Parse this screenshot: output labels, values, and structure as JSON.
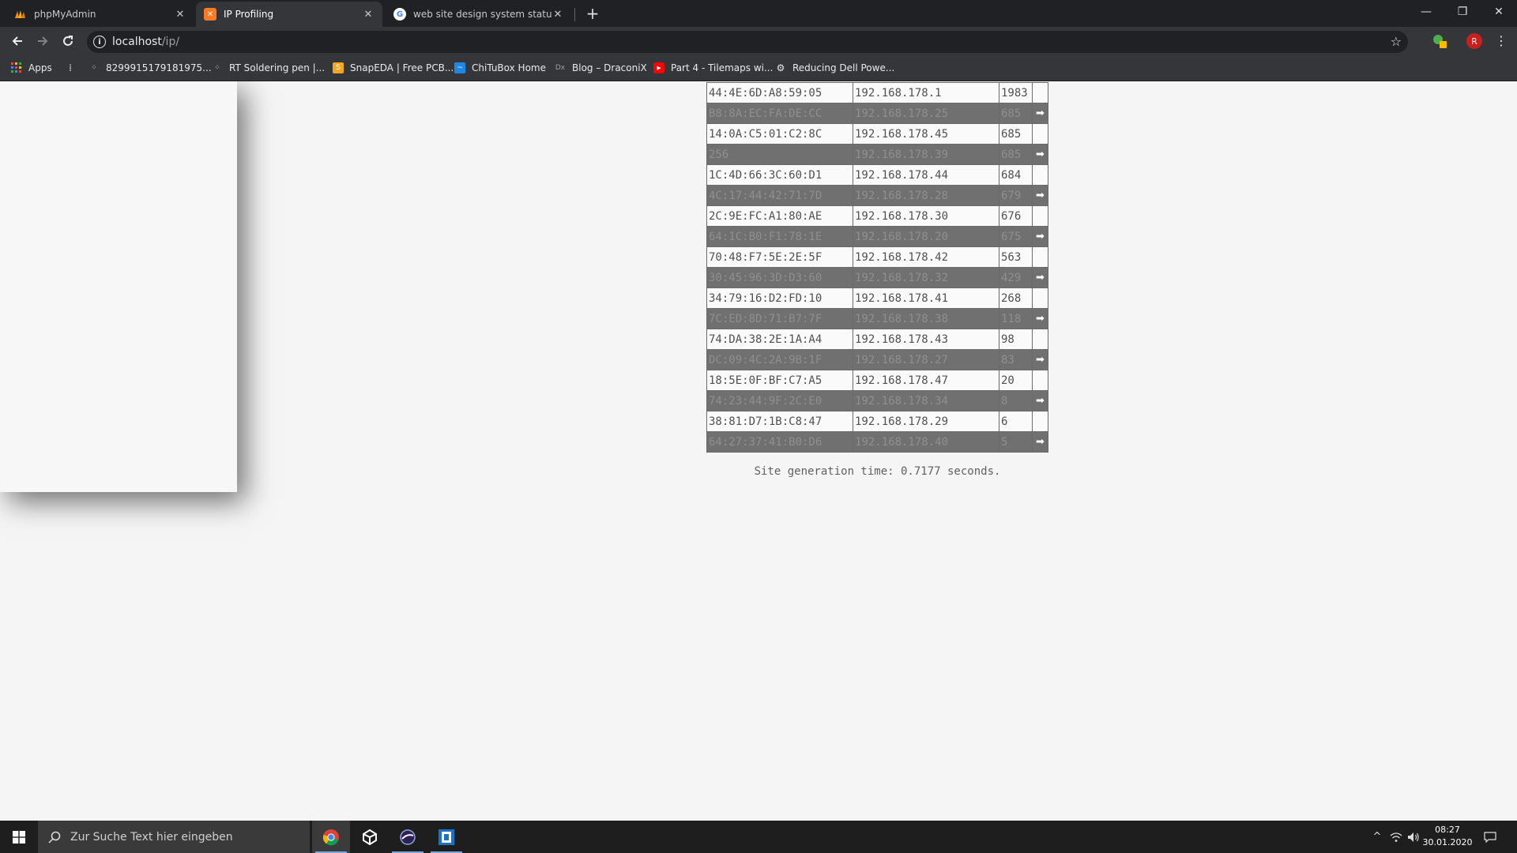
{
  "browser": {
    "tabs": [
      {
        "title": "phpMyAdmin",
        "icon": "phpmyadmin-icon",
        "active": false
      },
      {
        "title": "IP Profiling",
        "icon": "xampp-icon",
        "active": true
      },
      {
        "title": "web site design system status - G",
        "icon": "google-icon",
        "active": false
      }
    ],
    "new_tab_symbol": "+",
    "window_controls": {
      "minimize": "—",
      "restore": "❐",
      "close": "✕"
    },
    "url_host": "localhost",
    "url_path": "/ip/",
    "profile_initial": "R"
  },
  "bookmarks": [
    {
      "label": "Apps",
      "icon": "apps-grid-icon"
    },
    {
      "label": "",
      "icon": "bookmark-folder-icon"
    },
    {
      "label": "8299915179181975...",
      "icon": "dots-icon"
    },
    {
      "label": "RT Soldering pen |...",
      "icon": "dots-icon"
    },
    {
      "label": "SnapEDA | Free PCB...",
      "icon": "snapeda-icon"
    },
    {
      "label": "ChiTuBox Home",
      "icon": "chitubox-icon"
    },
    {
      "label": "Blog – DraconiX",
      "icon": "draconix-icon"
    },
    {
      "label": "Part 4 - Tilemaps wi...",
      "icon": "youtube-icon"
    },
    {
      "label": "Reducing Dell Powe...",
      "icon": "gear-site-icon"
    }
  ],
  "table": {
    "arrow_symbol": "➡",
    "rows": [
      {
        "mac": "44:4E:6D:A8:59:05",
        "ip": "192.168.178.1",
        "count": "1983",
        "style": "light"
      },
      {
        "mac": "B8:8A:EC:FA:DE:CC",
        "ip": "192.168.178.25",
        "count": "685",
        "style": "dark"
      },
      {
        "mac": "14:0A:C5:01:C2:8C",
        "ip": "192.168.178.45",
        "count": "685",
        "style": "light"
      },
      {
        "mac": "256",
        "ip": "192.168.178.39",
        "count": "685",
        "style": "dark"
      },
      {
        "mac": "1C:4D:66:3C:60:D1",
        "ip": "192.168.178.44",
        "count": "684",
        "style": "light"
      },
      {
        "mac": "4C:17:44:42:71:7D",
        "ip": "192.168.178.28",
        "count": "679",
        "style": "dark"
      },
      {
        "mac": "2C:9E:FC:A1:80:AE",
        "ip": "192.168.178.30",
        "count": "676",
        "style": "light"
      },
      {
        "mac": "64:1C:B0:F1:78:1E",
        "ip": "192.168.178.20",
        "count": "675",
        "style": "dark"
      },
      {
        "mac": "70:48:F7:5E:2E:5F",
        "ip": "192.168.178.42",
        "count": "563",
        "style": "light"
      },
      {
        "mac": "30:45:96:3D:D3:60",
        "ip": "192.168.178.32",
        "count": "429",
        "style": "dark"
      },
      {
        "mac": "34:79:16:D2:FD:10",
        "ip": "192.168.178.41",
        "count": "268",
        "style": "light"
      },
      {
        "mac": "7C:ED:8D:71:B7:7F",
        "ip": "192.168.178.38",
        "count": "118",
        "style": "dark"
      },
      {
        "mac": "74:DA:38:2E:1A:A4",
        "ip": "192.168.178.43",
        "count": "98",
        "style": "light"
      },
      {
        "mac": "DC:09:4C:2A:9B:1F",
        "ip": "192.168.178.27",
        "count": "83",
        "style": "dark"
      },
      {
        "mac": "18:5E:0F:BF:C7:A5",
        "ip": "192.168.178.47",
        "count": "20",
        "style": "light"
      },
      {
        "mac": "74:23:44:9F:2C:E0",
        "ip": "192.168.178.34",
        "count": "8",
        "style": "dark"
      },
      {
        "mac": "38:81:D7:1B:C8:47",
        "ip": "192.168.178.29",
        "count": "6",
        "style": "light"
      },
      {
        "mac": "64:27:37:41:B0:D6",
        "ip": "192.168.178.40",
        "count": "5",
        "style": "dark"
      }
    ]
  },
  "footer": {
    "generation_time": "Site generation time: 0.7177 seconds."
  },
  "taskbar": {
    "search_placeholder": "Zur Suche Text hier eingeben",
    "apps": [
      {
        "icon": "chrome-icon",
        "active": true
      },
      {
        "icon": "unity-icon",
        "active": false
      },
      {
        "icon": "eclipse-icon",
        "active": false
      },
      {
        "icon": "app-window-icon",
        "active": false
      }
    ],
    "clock_time": "08:27",
    "clock_date": "30.01.2020"
  },
  "colors": {
    "tabbar": "#202124",
    "toolbar": "#35363a",
    "row_dark": "#707070",
    "row_light": "#fafafa",
    "page_bg": "#f5f5f5"
  }
}
